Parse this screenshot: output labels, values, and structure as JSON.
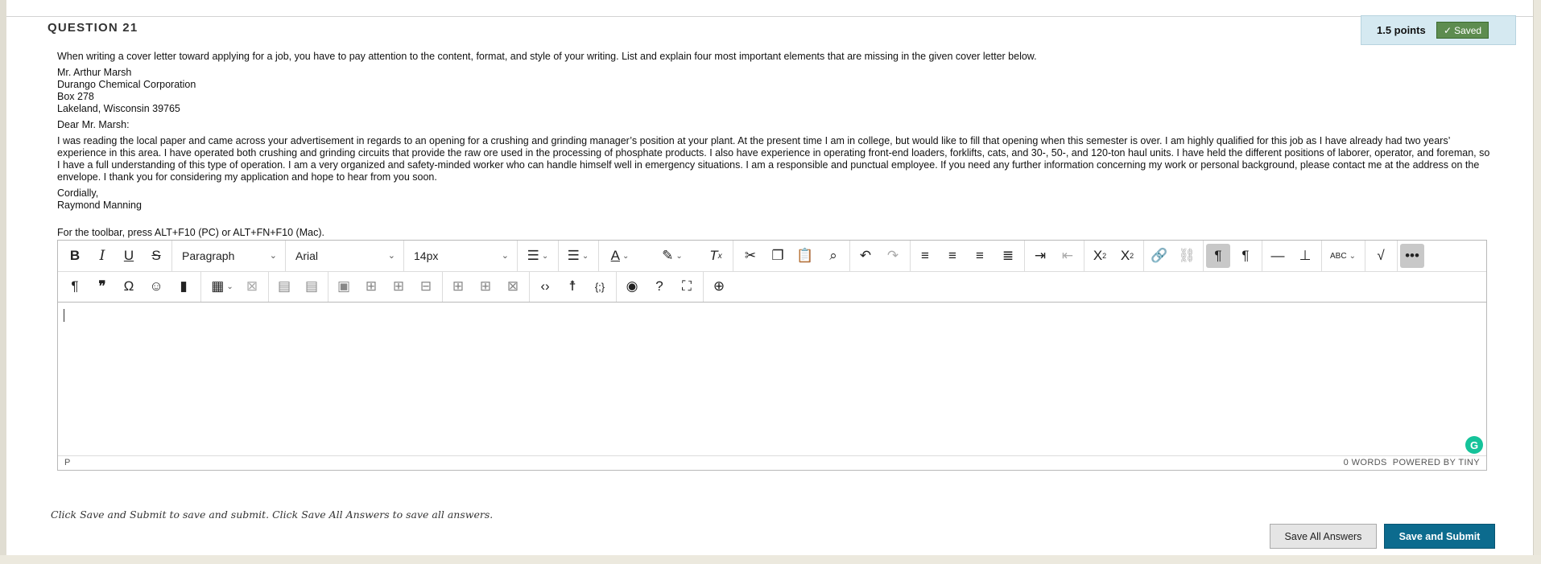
{
  "question": {
    "number_label": "QUESTION 21",
    "points": "1.5 points",
    "saved_label": "Saved",
    "prompt": "When writing a cover letter toward applying for a job, you have to pay attention to the content,  format, and style of your writing. List and explain four most important elements that are missing in the given cover letter below.",
    "address": [
      "Mr. Arthur Marsh",
      "Durango Chemical Corporation",
      "Box 278",
      "Lakeland, Wisconsin 39765"
    ],
    "salutation": "Dear Mr. Marsh:",
    "body": "I was reading the local paper and came across your advertisement in regards to an opening for a crushing and grinding manager’s position at your plant. At the present time I am in college, but would like to fill that opening when this semester is over. I am highly qualified for this job as I have already had two years’ experience in this area. I have operated both crushing and grinding circuits that provide the raw ore used in the processing of phosphate products. I also have experience in operating front-end loaders, forklifts, cats, and 30-, 50-, and 120-ton haul units. I have held the different positions of laborer, operator, and foreman, so I have a full understanding of this type of operation. I am a very organized and safety-minded worker who can handle himself well in emergency situations. I am a responsible and punctual employee. If you need any further information concerning my work or personal background, please contact me at the address on the envelope. I thank you for considering my application and hope to hear from you soon.",
    "closing": "Cordially,",
    "signature": "Raymond Manning"
  },
  "editor": {
    "toolbar_hint": "For the toolbar, press ALT+F10 (PC) or ALT+FN+F10 (Mac).",
    "block_format": "Paragraph",
    "font_family": "Arial",
    "font_size": "14px",
    "status_path": "P",
    "word_count": "0 WORDS",
    "powered_by": "POWERED BY TINY",
    "value": ""
  },
  "footer": {
    "instruction": "Click Save and Submit to save and submit. Click Save All Answers to save all answers.",
    "save_all_label": "Save All Answers",
    "save_submit_label": "Save and Submit"
  },
  "icons": {
    "toolbar_row1": [
      "bold-icon",
      "italic-icon",
      "underline-icon",
      "strikethrough-icon",
      "bullet-list-icon",
      "numbered-list-icon",
      "text-color-icon",
      "highlight-icon",
      "clear-formatting-icon",
      "cut-icon",
      "copy-icon",
      "paste-icon",
      "find-icon",
      "undo-icon",
      "redo-icon",
      "align-left-icon",
      "align-center-icon",
      "align-right-icon",
      "justify-icon",
      "indent-icon",
      "outdent-icon",
      "superscript-icon",
      "subscript-icon",
      "link-icon",
      "unlink-icon",
      "ltr-icon",
      "rtl-icon",
      "horizontal-line-icon",
      "insert-icon",
      "spellcheck-icon",
      "math-icon",
      "more-icon"
    ],
    "toolbar_row2": [
      "paragraph-mark-icon",
      "blockquote-icon",
      "omega-icon",
      "emoji-icon",
      "bookmark-icon",
      "table-icon",
      "table-delete-icon",
      "row-before-icon",
      "row-after-icon",
      "cell-props-icon",
      "split-cell-icon",
      "merge-cell-icon",
      "delete-row-icon",
      "col-before-icon",
      "col-after-icon",
      "delete-col-icon",
      "code-icon",
      "accessibility-icon",
      "template-vars-icon",
      "preview-icon",
      "help-icon",
      "fullscreen-icon",
      "add-content-icon"
    ]
  },
  "colors": {
    "points_bg": "#d5e9f1",
    "saved_badge": "#5d8c4f",
    "submit_button": "#0c6b8e",
    "grammarly": "#15c39a"
  }
}
